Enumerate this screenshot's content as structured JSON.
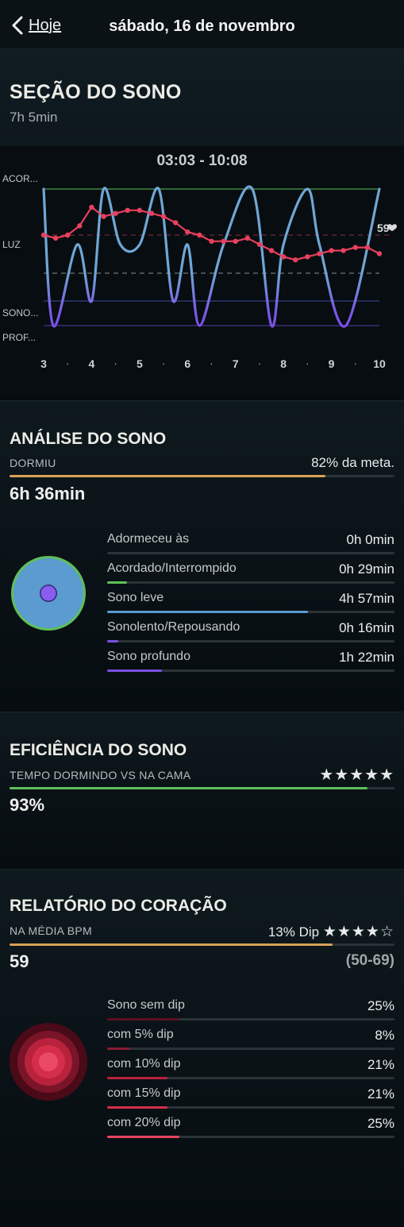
{
  "nav": {
    "back_label": "Hoje",
    "title": "sábado, 16 de novembro"
  },
  "session": {
    "title": "SEÇÃO DO SONO",
    "duration": "7h 5min",
    "time_range": "03:03 - 10:08",
    "hr_badge": "59",
    "y_labels": [
      "ACOR...",
      "LUZ",
      "SONO...",
      "PROF..."
    ],
    "x_labels": [
      "3",
      "4",
      "5",
      "6",
      "7",
      "8",
      "9",
      "10"
    ]
  },
  "chart_data": {
    "type": "line",
    "title": "03:03 - 10:08",
    "xlim": [
      3,
      10
    ],
    "y_categories": [
      "ACOR...",
      "LUZ",
      "SONO...",
      "PROF..."
    ],
    "x_ticks": [
      "3",
      "4",
      "5",
      "6",
      "7",
      "8",
      "9",
      "10"
    ],
    "series": [
      {
        "values": [
          {
            "x": 3.0,
            "y": "ACOR..."
          },
          {
            "x": 3.2,
            "y": "PROF..."
          },
          {
            "x": 3.7,
            "y": "LUZ"
          },
          {
            "x": 4.0,
            "y": "SONO..."
          },
          {
            "x": 4.25,
            "y": "ACOR..."
          },
          {
            "x": 4.6,
            "y": "LUZ"
          },
          {
            "x": 5.0,
            "y": "LUZ"
          },
          {
            "x": 5.4,
            "y": "ACOR..."
          },
          {
            "x": 5.7,
            "y": "SONO..."
          },
          {
            "x": 6.0,
            "y": "LUZ"
          },
          {
            "x": 6.25,
            "y": "PROF..."
          },
          {
            "x": 6.75,
            "y": "LUZ"
          },
          {
            "x": 7.35,
            "y": "ACOR..."
          },
          {
            "x": 7.75,
            "y": "PROF..."
          },
          {
            "x": 8.0,
            "y": "LUZ"
          },
          {
            "x": 8.5,
            "y": "ACOR..."
          },
          {
            "x": 8.75,
            "y": "LUZ"
          },
          {
            "x": 9.3,
            "y": "PROF..."
          },
          {
            "x": 10.0,
            "y": "ACOR..."
          }
        ]
      },
      {
        "values": [
          {
            "x": 3.0,
            "y": 65
          },
          {
            "x": 3.25,
            "y": 64
          },
          {
            "x": 3.5,
            "y": 65
          },
          {
            "x": 3.75,
            "y": 68
          },
          {
            "x": 4.0,
            "y": 74
          },
          {
            "x": 4.25,
            "y": 71
          },
          {
            "x": 4.5,
            "y": 72
          },
          {
            "x": 4.75,
            "y": 73
          },
          {
            "x": 5.0,
            "y": 73
          },
          {
            "x": 5.25,
            "y": 72
          },
          {
            "x": 5.5,
            "y": 71
          },
          {
            "x": 5.75,
            "y": 69
          },
          {
            "x": 6.0,
            "y": 66
          },
          {
            "x": 6.25,
            "y": 65
          },
          {
            "x": 6.5,
            "y": 63
          },
          {
            "x": 6.75,
            "y": 63
          },
          {
            "x": 7.0,
            "y": 63
          },
          {
            "x": 7.25,
            "y": 64
          },
          {
            "x": 7.5,
            "y": 62
          },
          {
            "x": 7.75,
            "y": 60
          },
          {
            "x": 8.0,
            "y": 58
          },
          {
            "x": 8.25,
            "y": 57
          },
          {
            "x": 8.5,
            "y": 58
          },
          {
            "x": 8.75,
            "y": 59
          },
          {
            "x": 9.0,
            "y": 60
          },
          {
            "x": 9.25,
            "y": 60
          },
          {
            "x": 9.5,
            "y": 61
          },
          {
            "x": 9.75,
            "y": 61
          },
          {
            "x": 10.0,
            "y": 59
          }
        ]
      }
    ],
    "colors": {
      "sleep_line": "#6fa6d6",
      "heart_rate": "#e8405f",
      "awake": "#5fbf5a",
      "deep": "#7b4fe0"
    }
  },
  "analysis": {
    "title": "ANÁLISE DO SONO",
    "caption": "DORMIU",
    "goal_text": "82% da meta.",
    "goal_fraction": 0.82,
    "total": "6h 36min",
    "rows": [
      {
        "label": "Adormeceu às",
        "value": "0h 0min",
        "fraction": 0.0,
        "color": "#5fbf5a"
      },
      {
        "label": "Acordado/Interrompido",
        "value": "0h 29min",
        "fraction": 0.07,
        "color": "#5fbf5a"
      },
      {
        "label": "Sono leve",
        "value": "4h 57min",
        "fraction": 0.7,
        "color": "#5b9bd0"
      },
      {
        "label": "Sonolento/Repousando",
        "value": "0h 16min",
        "fraction": 0.04,
        "color": "#7b4fe0"
      },
      {
        "label": "Sono profundo",
        "value": "1h 22min",
        "fraction": 0.19,
        "color": "#7b4fe0"
      }
    ]
  },
  "efficiency": {
    "title": "EFICIÊNCIA DO SONO",
    "caption": "TEMPO DORMINDO VS NA CAMA",
    "stars": "★★★★★",
    "value": "93%",
    "fraction": 0.93
  },
  "heart": {
    "title": "RELATÓRIO DO CORAÇÃO",
    "caption": "NA MÉDIA BPM",
    "dip_text": "13% Dip",
    "stars": "★★★★☆",
    "bpm": "59",
    "range": "(50-69)",
    "fraction": 0.84,
    "rows": [
      {
        "label": "Sono sem dip",
        "value": "25%",
        "fraction": 0.25,
        "color": "#5c1020"
      },
      {
        "label": "com 5% dip",
        "value": "8%",
        "fraction": 0.08,
        "color": "#8a1a2e"
      },
      {
        "label": "com 10% dip",
        "value": "21%",
        "fraction": 0.21,
        "color": "#b8223c"
      },
      {
        "label": "com 15% dip",
        "value": "21%",
        "fraction": 0.21,
        "color": "#d42e4a"
      },
      {
        "label": "com 20% dip",
        "value": "25%",
        "fraction": 0.25,
        "color": "#e84560"
      }
    ]
  }
}
